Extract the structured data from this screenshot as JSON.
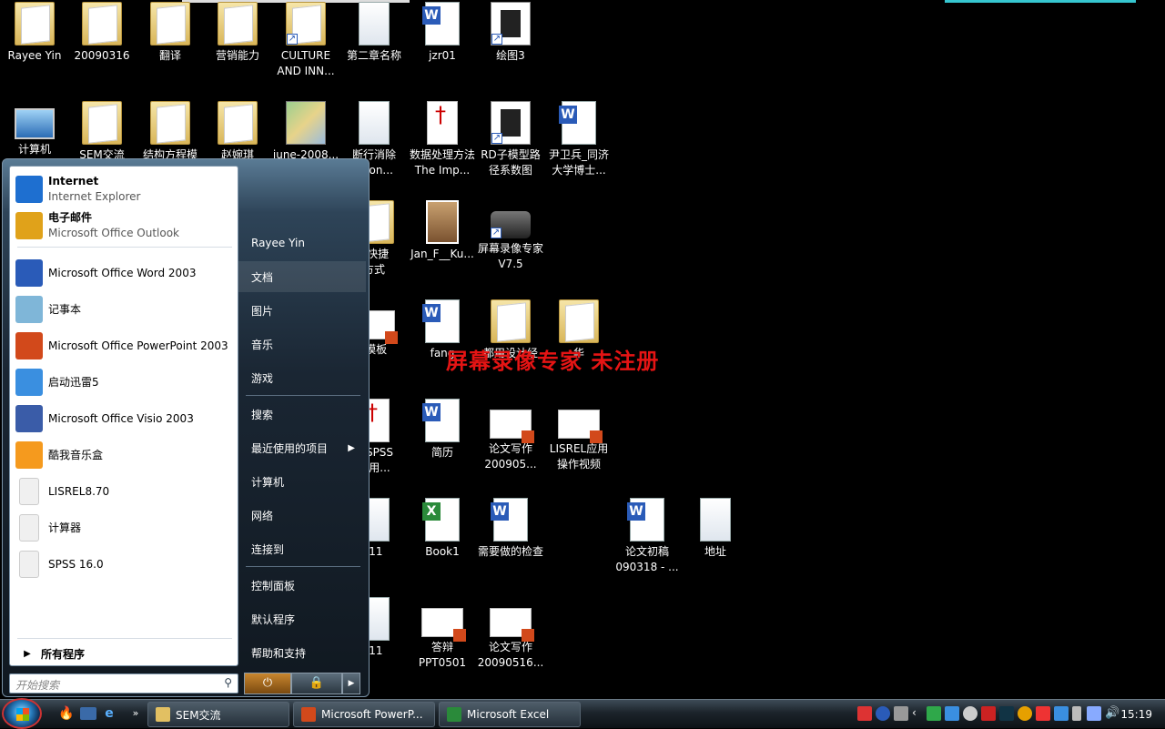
{
  "desktop": {
    "icons": [
      {
        "label": "Rayee Yin",
        "type": "user-folder",
        "col": 0,
        "row": 0
      },
      {
        "label": "20090316",
        "type": "folder",
        "col": 1,
        "row": 0
      },
      {
        "label": "翻译",
        "type": "folder",
        "col": 2,
        "row": 0
      },
      {
        "label": "营销能力",
        "type": "folder",
        "col": 3,
        "row": 0
      },
      {
        "label": "CULTURE AND INN...",
        "type": "folder-shortcut",
        "col": 4,
        "row": 0
      },
      {
        "label": "第二章名称",
        "type": "doc",
        "col": 5,
        "row": 0
      },
      {
        "label": "jzr01",
        "type": "word",
        "col": 6,
        "row": 0
      },
      {
        "label": "绘图3",
        "type": "pic",
        "col": 7,
        "row": 0
      },
      {
        "label": "计算机",
        "type": "pc",
        "col": 0,
        "row": 1
      },
      {
        "label": "SEM交流",
        "type": "folder",
        "col": 1,
        "row": 1
      },
      {
        "label": "结构方程模",
        "type": "folder",
        "col": 2,
        "row": 1
      },
      {
        "label": "赵婉琪",
        "type": "folder",
        "col": 3,
        "row": 1
      },
      {
        "label": "june-2008...",
        "type": "map",
        "col": 4,
        "row": 1
      },
      {
        "label": "断行消除\nation...",
        "type": "doc",
        "col": 5,
        "row": 1
      },
      {
        "label": "数据处理方法The Imp...",
        "type": "pdf",
        "col": 6,
        "row": 1
      },
      {
        "label": "RD子模型路径系数图",
        "type": "pic",
        "col": 7,
        "row": 1
      },
      {
        "label": "尹卫兵_同济大学博士...",
        "type": "word",
        "col": 8,
        "row": 1
      },
      {
        "label": "- 快捷\n方式",
        "type": "folder",
        "col": 5,
        "row": 2
      },
      {
        "label": "Jan_F__Ku...",
        "type": "photo",
        "col": 6,
        "row": 2
      },
      {
        "label": "屏幕录像专家V7.5",
        "type": "cam",
        "col": 7,
        "row": 2
      },
      {
        "label": "f模板",
        "type": "ppt",
        "col": 5,
        "row": 3
      },
      {
        "label": "fang",
        "type": "word",
        "col": 6,
        "row": 3
      },
      {
        "label": "都用设计经",
        "type": "folder",
        "col": 7,
        "row": 3
      },
      {
        "label": "华",
        "type": "folder",
        "col": 8,
        "row": 3
      },
      {
        "label": "隆SPSS\n应用...",
        "type": "pdf",
        "col": 5,
        "row": 4
      },
      {
        "label": "简历",
        "type": "word",
        "col": 6,
        "row": 4
      },
      {
        "label": "论文写作200905...",
        "type": "ppt",
        "col": 7,
        "row": 4
      },
      {
        "label": "LISREL应用操作视频",
        "type": "ppt",
        "col": 8,
        "row": 4
      },
      {
        "label": ".11",
        "type": "doc",
        "col": 5,
        "row": 5
      },
      {
        "label": "Book1",
        "type": "excel",
        "col": 6,
        "row": 5
      },
      {
        "label": "需要做的检查",
        "type": "word",
        "col": 7,
        "row": 5
      },
      {
        "label": "论文初稿090318 - ...",
        "type": "word",
        "col": 9,
        "row": 5
      },
      {
        "label": "地址",
        "type": "doc",
        "col": 10,
        "row": 5
      },
      {
        "label": ".11",
        "type": "doc",
        "col": 5,
        "row": 6
      },
      {
        "label": "答辩PPT0501",
        "type": "ppt",
        "col": 6,
        "row": 6
      },
      {
        "label": "论文写作20090516...",
        "type": "ppt",
        "col": 7,
        "row": 6
      }
    ],
    "watermark": "屏幕录像专家  未注册"
  },
  "start_menu": {
    "pinned": [
      {
        "title": "Internet",
        "subtitle": "Internet Explorer",
        "icon": "internet-explorer-icon",
        "color": "#1e6fd0"
      },
      {
        "title": "电子邮件",
        "subtitle": "Microsoft Office Outlook",
        "icon": "outlook-icon",
        "color": "#e0a21a"
      }
    ],
    "recent": [
      {
        "title": "Microsoft Office Word 2003",
        "icon": "word-icon",
        "color": "#2a5bb8"
      },
      {
        "title": "记事本",
        "icon": "notepad-icon",
        "color": "#7fb6d8"
      },
      {
        "title": "Microsoft Office PowerPoint 2003",
        "icon": "powerpoint-icon",
        "color": "#d2491b"
      },
      {
        "title": "启动迅雷5",
        "icon": "thunder-icon",
        "color": "#3a8fe0"
      },
      {
        "title": "Microsoft Office Visio 2003",
        "icon": "visio-icon",
        "color": "#3a5ca8"
      },
      {
        "title": "酷我音乐盒",
        "icon": "kuwo-icon",
        "color": "#f59a1e"
      },
      {
        "title": "LISREL8.70",
        "icon": "lisrel-icon",
        "color": "#f0f0f0"
      },
      {
        "title": "计算器",
        "icon": "calculator-icon",
        "color": "#f0f0f0"
      },
      {
        "title": "SPSS 16.0",
        "icon": "spss-icon",
        "color": "#f0f0f0"
      }
    ],
    "all_programs": "所有程序",
    "search_placeholder": "开始搜索",
    "right_items": [
      {
        "label": "Rayee Yin",
        "highlight": false,
        "chevron": false
      },
      {
        "label": "文档",
        "highlight": true,
        "chevron": false
      },
      {
        "label": "图片",
        "highlight": false,
        "chevron": false
      },
      {
        "label": "音乐",
        "highlight": false,
        "chevron": false
      },
      {
        "label": "游戏",
        "highlight": false,
        "chevron": false
      },
      {
        "label": "搜索",
        "highlight": false,
        "chevron": false
      },
      {
        "label": "最近使用的项目",
        "highlight": false,
        "chevron": true
      },
      {
        "label": "计算机",
        "highlight": false,
        "chevron": false
      },
      {
        "label": "网络",
        "highlight": false,
        "chevron": false
      },
      {
        "label": "连接到",
        "highlight": false,
        "chevron": false
      },
      {
        "label": "控制面板",
        "highlight": false,
        "chevron": false
      },
      {
        "label": "默认程序",
        "highlight": false,
        "chevron": false
      },
      {
        "label": "帮助和支持",
        "highlight": false,
        "chevron": false
      }
    ]
  },
  "taskbar": {
    "buttons": [
      {
        "label": "SEM交流",
        "icon": "folder-icon",
        "color": "#e2c062"
      },
      {
        "label": "Microsoft PowerP...",
        "icon": "powerpoint-icon",
        "color": "#d2491b"
      },
      {
        "label": "Microsoft Excel",
        "icon": "excel-icon",
        "color": "#2a8a3a"
      }
    ],
    "clock": "15:19"
  }
}
